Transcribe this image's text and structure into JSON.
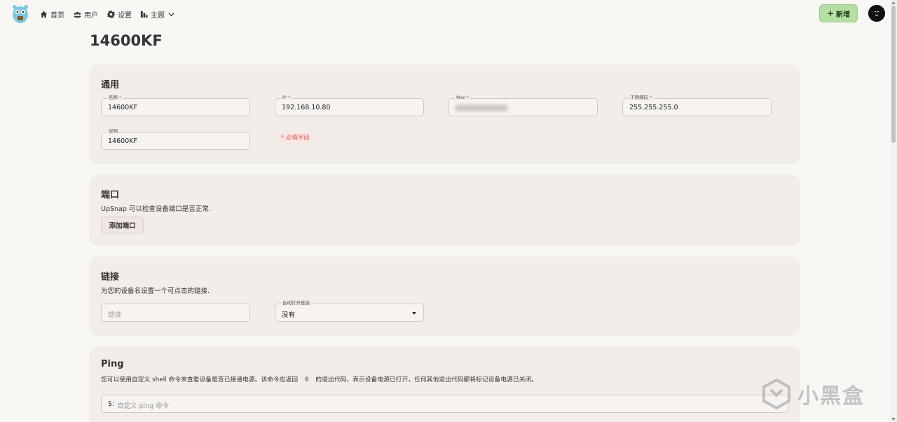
{
  "nav": {
    "home": "首页",
    "users": "用户",
    "settings": "设置",
    "theme": "主题",
    "add_button": "新增"
  },
  "page": {
    "title": "14600KF"
  },
  "general": {
    "title": "通用",
    "name_label": "名称",
    "name_value": "14600KF",
    "ip_label": "IP",
    "ip_value": "192.168.10.80",
    "mac_label": "Mac",
    "netmask_label": "子网掩码",
    "netmask_value": "255.255.255.0",
    "desc_label": "说明",
    "desc_value": "14600KF",
    "required_star": "*",
    "required_note": "* 必填字段"
  },
  "ports": {
    "title": "端口",
    "desc": "UpSnap 可以检查设备端口是否正常.",
    "add_button": "添加端口"
  },
  "link": {
    "title": "链接",
    "desc": "为您的设备名设置一个可点击的链接.",
    "link_placeholder": "链接",
    "auto_open_label": "自动打开链接",
    "auto_open_value": "没有"
  },
  "ping": {
    "title": "Ping",
    "desc_before": "您可以使用自定义 shell 命令来查看设备是否已接通电源。该命令应返回",
    "desc_code": "0",
    "desc_after": "的退出代码，表示设备电源已打开，任何其他退出代码都将标记设备电源已关闭。",
    "prompt": "$:",
    "placeholder": "自定义 ping 命令"
  },
  "watermark": {
    "text": "小黑盒"
  },
  "colors": {
    "background": "#f9f7f4",
    "card": "#f2ede8",
    "add_button": "#b5dfa5",
    "required": "#e05a5a"
  }
}
